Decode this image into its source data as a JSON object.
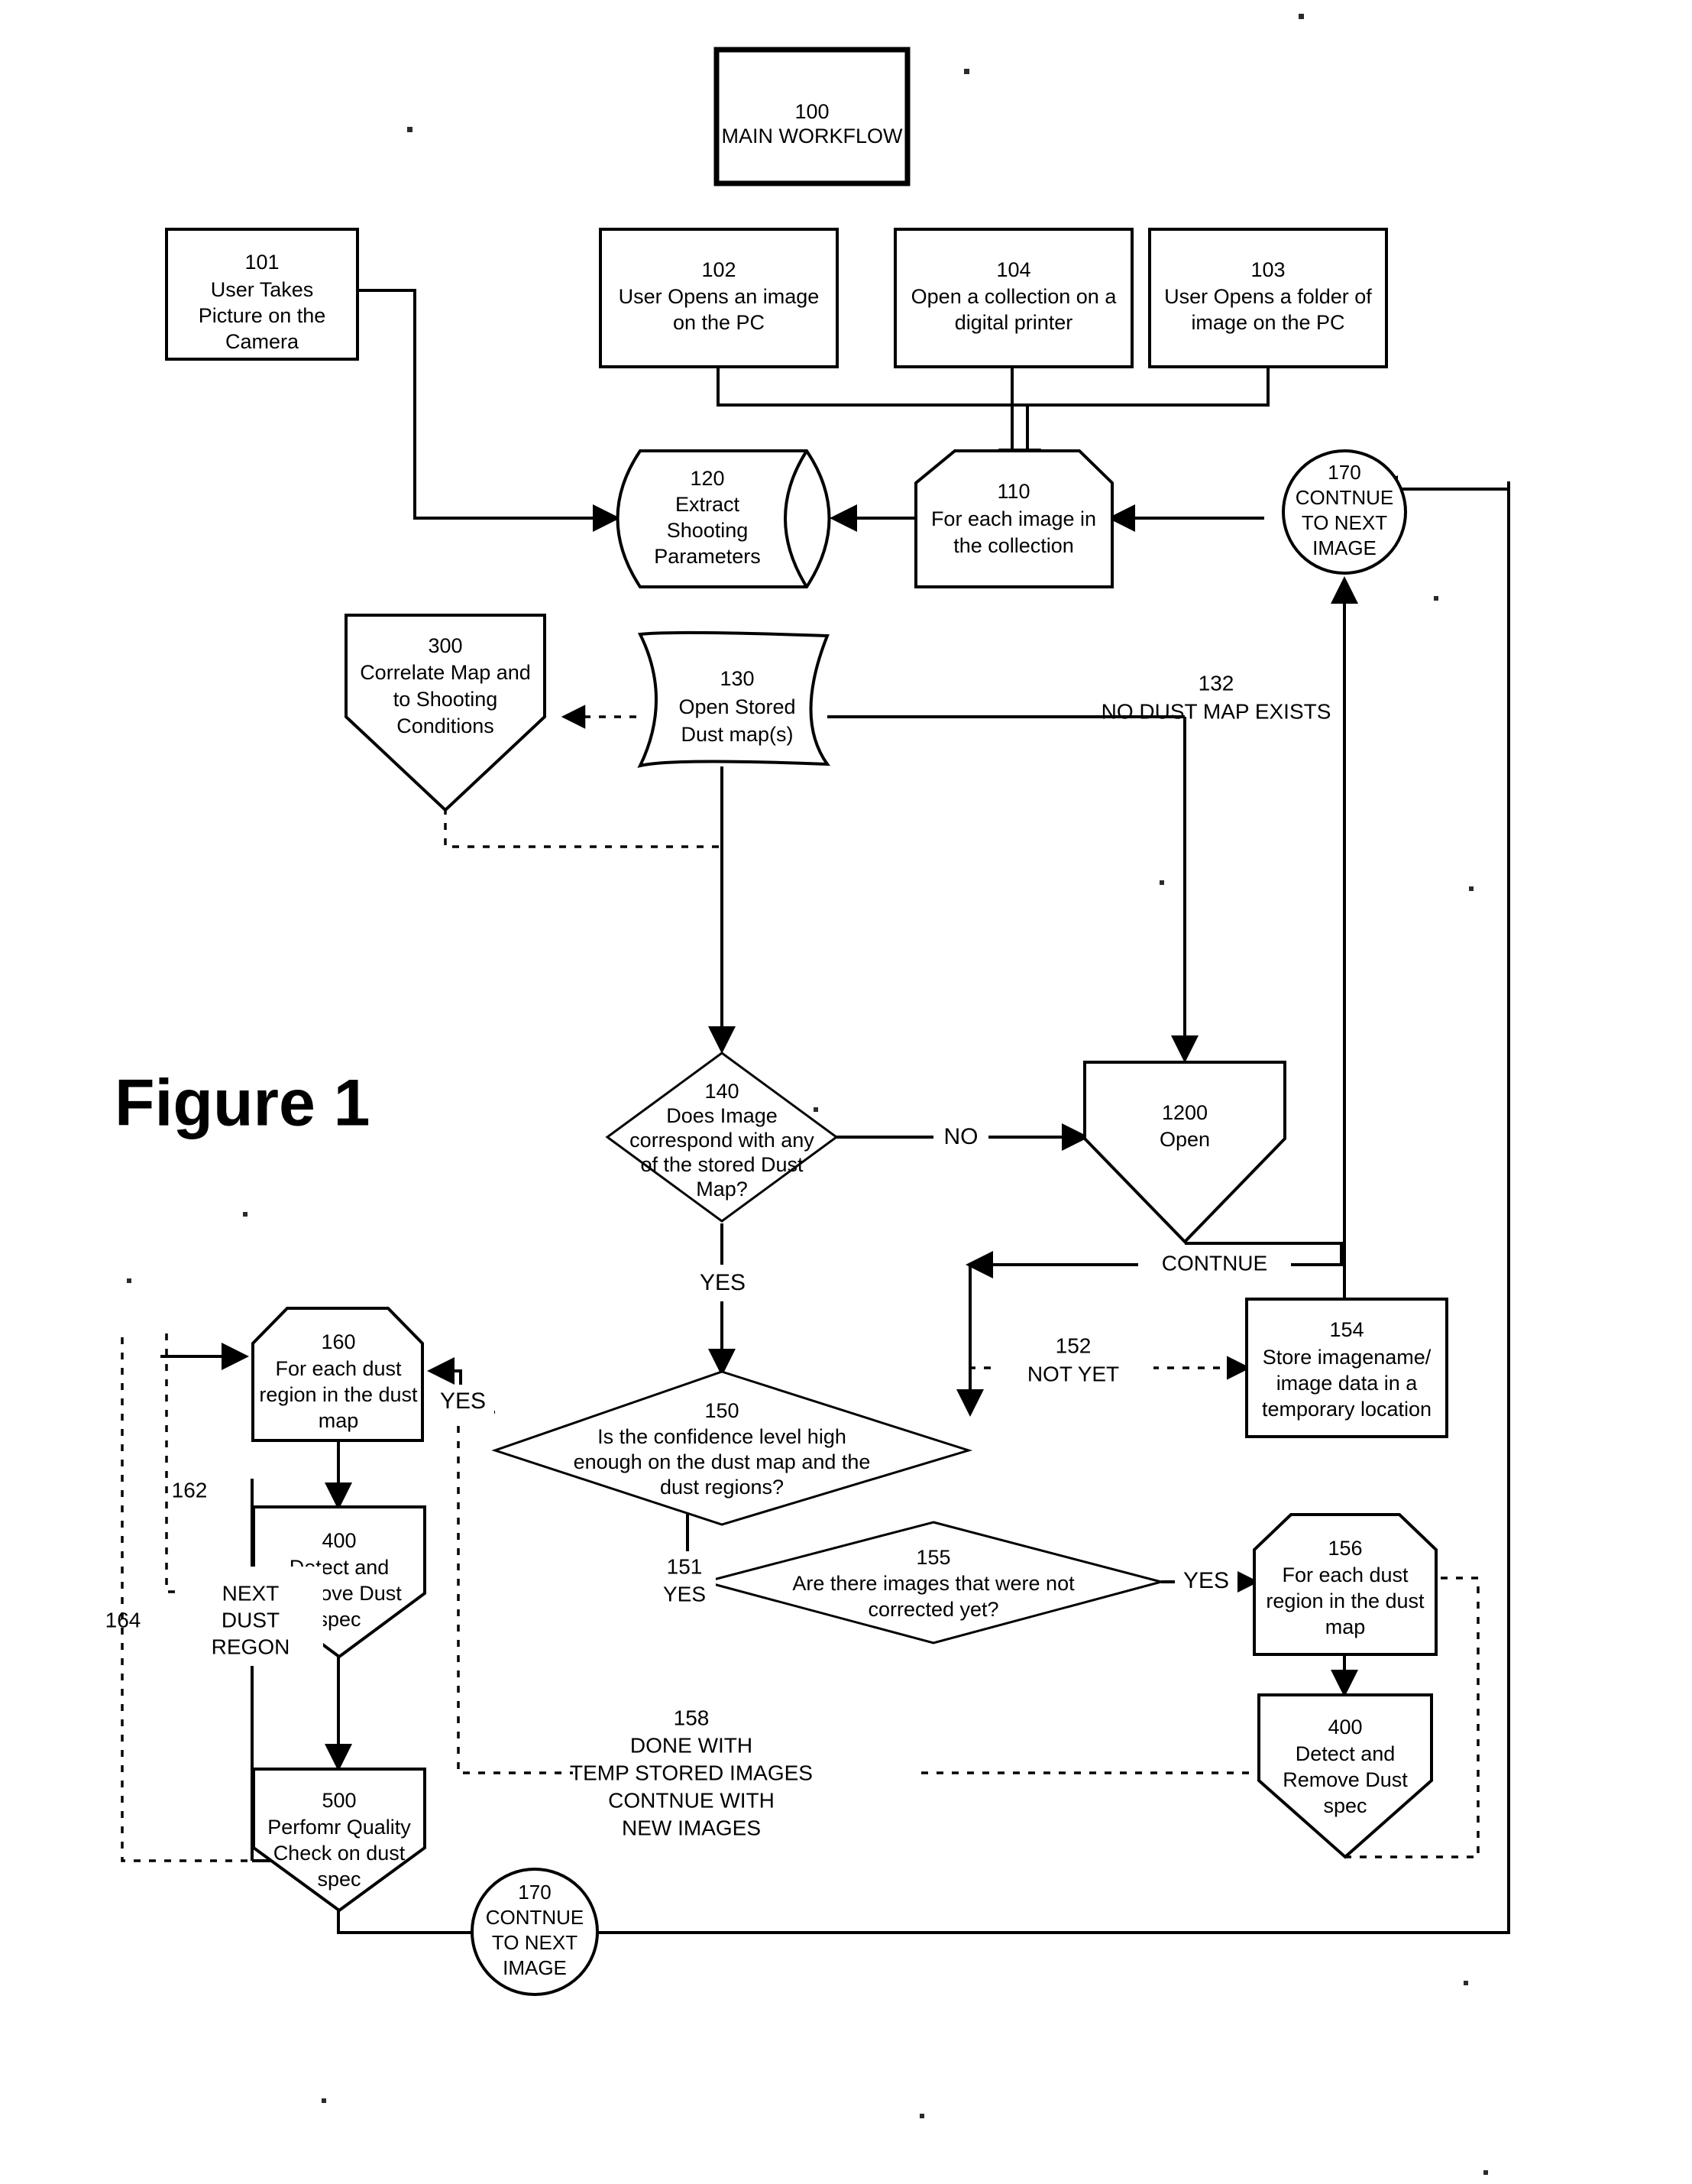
{
  "figure": {
    "caption": "Figure 1"
  },
  "nodes": {
    "n100": {
      "num": "100",
      "lines": [
        "MAIN WORKFLOW"
      ]
    },
    "n101": {
      "num": "101",
      "lines": [
        "User Takes",
        "Picture on the",
        "Camera"
      ]
    },
    "n102": {
      "num": "102",
      "lines": [
        "User Opens an image",
        "on the PC"
      ]
    },
    "n104": {
      "num": "104",
      "lines": [
        "Open a collection on a",
        "digital printer"
      ]
    },
    "n103": {
      "num": "103",
      "lines": [
        "User Opens a folder of",
        "image on the PC"
      ]
    },
    "n120": {
      "num": "120",
      "lines": [
        "Extract",
        "Shooting",
        "Parameters"
      ]
    },
    "n110": {
      "num": "110",
      "lines": [
        "For each image in",
        "the collection"
      ]
    },
    "n170a": {
      "num": "170",
      "lines": [
        "CONTNUE",
        "TO NEXT",
        "IMAGE"
      ]
    },
    "n300": {
      "num": "300",
      "lines": [
        "Correlate Map and",
        "to Shooting",
        "Conditions"
      ]
    },
    "n130": {
      "num": "130",
      "lines": [
        "Open Stored",
        "Dust map(s)"
      ]
    },
    "n140": {
      "num": "140",
      "lines": [
        "Does Image",
        "correspond with any",
        "of the stored Dust",
        "Map?"
      ]
    },
    "n1200": {
      "num": "1200",
      "lines": [
        "Open"
      ]
    },
    "n160": {
      "num": "160",
      "lines": [
        "For each dust",
        "region in the dust",
        "map"
      ]
    },
    "n150": {
      "num": "150",
      "lines": [
        "Is the confidence level high",
        "enough on the dust map and the",
        "dust regions?"
      ]
    },
    "n154": {
      "num": "154",
      "lines": [
        "Store imagename/",
        "image data in a",
        "temporary location"
      ]
    },
    "n155": {
      "num": "155",
      "lines": [
        "Are there images that were not",
        "corrected yet?"
      ]
    },
    "n156": {
      "num": "156",
      "lines": [
        "For each dust",
        "region in the dust",
        "map"
      ]
    },
    "n400a": {
      "num": "400",
      "lines": [
        "Detect and",
        "Remove Dust",
        "spec"
      ]
    },
    "n400b": {
      "num": "400",
      "lines": [
        "Detect and",
        "Remove Dust",
        "spec"
      ]
    },
    "n500": {
      "num": "500",
      "lines": [
        "Perfomr Quality",
        "Check on dust",
        "spec"
      ]
    },
    "n170b": {
      "num": "170",
      "lines": [
        "CONTNUE",
        "TO NEXT",
        "IMAGE"
      ]
    }
  },
  "edge_labels": {
    "e132": {
      "num": "132",
      "text": "NO DUST MAP EXISTS"
    },
    "e140_no": {
      "text": "NO"
    },
    "e140_yes": {
      "text": "YES"
    },
    "e_continue": {
      "text": "CONTNUE"
    },
    "e152": {
      "num": "152",
      "text": "NOT YET"
    },
    "e150_yes": {
      "text": "YES"
    },
    "e151": {
      "num": "151",
      "text": "YES"
    },
    "e155_yes": {
      "text": "YES"
    },
    "e162": {
      "num": "162"
    },
    "e164": {
      "num": "164"
    },
    "e_next_dust_region": {
      "lines": [
        "NEXT",
        "DUST",
        "REGON"
      ]
    },
    "e158": {
      "num": "158",
      "lines": [
        "DONE WITH",
        "TEMP STORED IMAGES",
        "CONTNUE WITH",
        "NEW IMAGES"
      ]
    }
  },
  "colors": {
    "stroke": "#000000",
    "background": "#ffffff"
  }
}
